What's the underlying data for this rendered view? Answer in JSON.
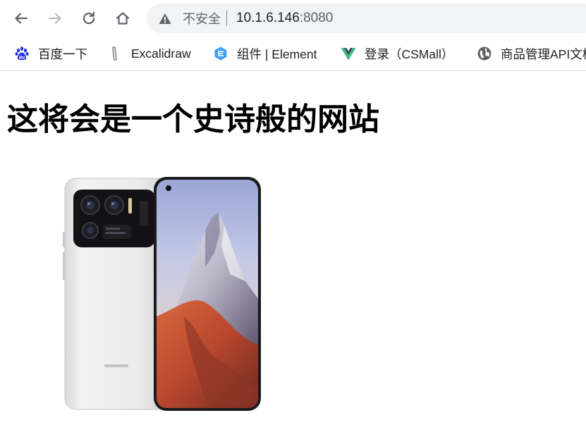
{
  "browser": {
    "security_label": "不安全",
    "url_host": "10.1.6.146",
    "url_port": ":8080",
    "bookmarks": [
      {
        "label": "百度一下",
        "icon": "baidu-paw-icon"
      },
      {
        "label": "Excalidraw",
        "icon": "excalidraw-icon"
      },
      {
        "label": "组件 | Element",
        "icon": "element-hexagon-icon"
      },
      {
        "label": "登录（CSMall）",
        "icon": "vue-logo-icon"
      },
      {
        "label": "商品管理API文档",
        "icon": "globe-icon"
      }
    ]
  },
  "page": {
    "title": "这将会是一个史诗般的网站"
  },
  "colors": {
    "omnibox_bg": "#f1f3f4",
    "element_blue": "#409eff",
    "vue_green": "#41b883",
    "baidu_blue": "#2932e1"
  }
}
